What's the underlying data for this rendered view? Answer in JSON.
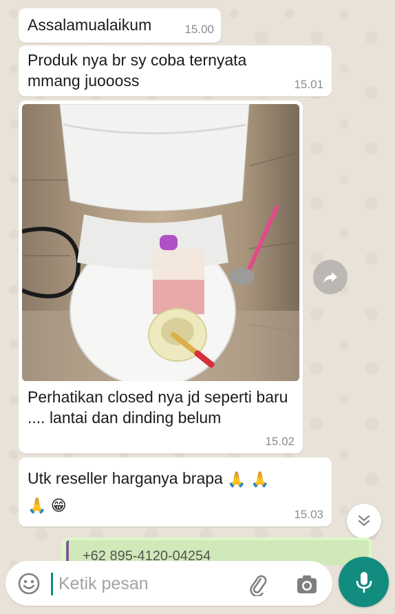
{
  "messages": [
    {
      "text": "Assalamualaikum",
      "time": "15.00"
    },
    {
      "text": "Produk nya br sy coba ternyata mmang juoooss",
      "time": "15.01"
    },
    {
      "type": "image",
      "caption": "Perhatikan closed nya jd seperti baru .... lantai dan dinding belum",
      "time": "15.02"
    },
    {
      "text": "Utk reseller harganya brapa",
      "emojis": [
        "🙏",
        "🙏",
        "🙏",
        "😁"
      ],
      "time": "15.03"
    }
  ],
  "outgoing_preview": {
    "text": "+62 895-4120-04254"
  },
  "composer": {
    "placeholder": "Ketik pesan"
  },
  "icons": {
    "emoji": "smiley-icon",
    "attach": "paperclip-icon",
    "camera": "camera-icon",
    "mic": "microphone-icon",
    "forward": "forward-arrow-icon",
    "scroll": "double-chevron-down-icon"
  },
  "colors": {
    "accent": "#128c7e",
    "outgoing_bubble": "#dcf8c6",
    "chat_bg": "#e9e2d8"
  }
}
